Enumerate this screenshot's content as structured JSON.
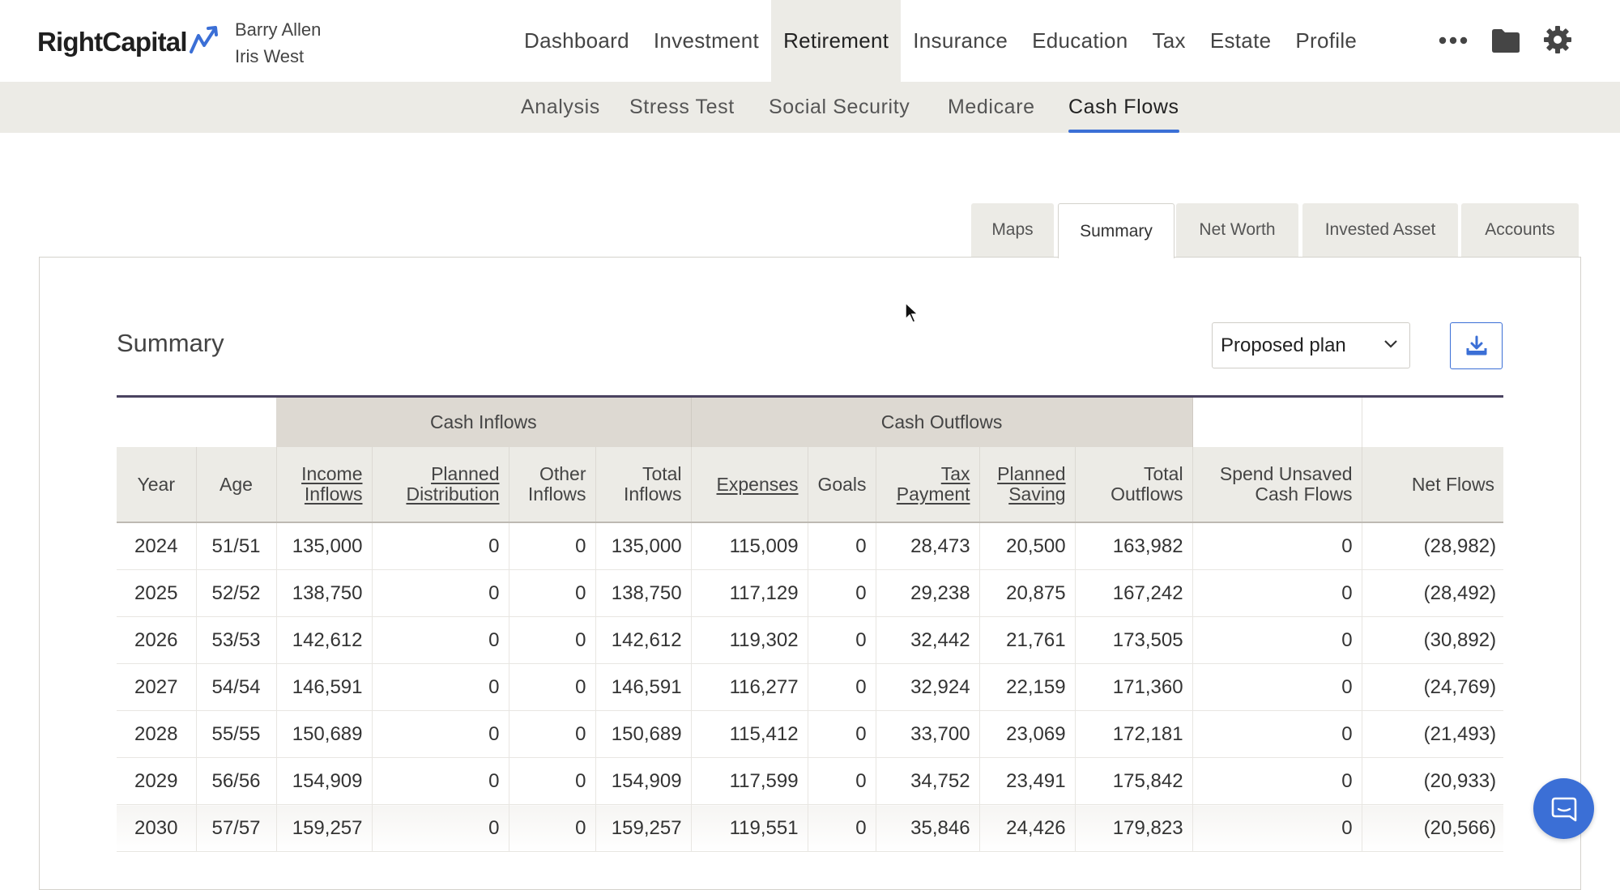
{
  "brand": {
    "logo": "RightCapital",
    "accent": "#3b6fd6"
  },
  "clients": [
    "Barry Allen",
    "Iris West"
  ],
  "main_nav": [
    {
      "label": "Dashboard",
      "active": false
    },
    {
      "label": "Investment",
      "active": false
    },
    {
      "label": "Retirement",
      "active": true
    },
    {
      "label": "Insurance",
      "active": false
    },
    {
      "label": "Education",
      "active": false
    },
    {
      "label": "Tax",
      "active": false
    },
    {
      "label": "Estate",
      "active": false
    },
    {
      "label": "Profile",
      "active": false
    }
  ],
  "nav_icons": {
    "more": "more-dots-icon",
    "folder": "folder-icon",
    "settings": "gear-icon"
  },
  "sub_nav": [
    {
      "label": "Analysis",
      "active": false
    },
    {
      "label": "Stress Test",
      "active": false
    },
    {
      "label": "Social Security",
      "active": false
    },
    {
      "label": "Medicare",
      "active": false
    },
    {
      "label": "Cash Flows",
      "active": true
    }
  ],
  "tabs": [
    {
      "label": "Maps",
      "active": false
    },
    {
      "label": "Summary",
      "active": true
    },
    {
      "label": "Net Worth",
      "active": false
    },
    {
      "label": "Invested Asset",
      "active": false
    },
    {
      "label": "Accounts",
      "active": false
    }
  ],
  "summary": {
    "title": "Summary",
    "plan_select": "Proposed plan",
    "download_icon": "download-icon"
  },
  "table": {
    "groups": {
      "inflows": "Cash Inflows",
      "outflows": "Cash Outflows"
    },
    "headers": [
      {
        "label": "Year",
        "underline": false
      },
      {
        "label": "Age",
        "underline": false
      },
      {
        "label": "Income Inflows",
        "underline": true
      },
      {
        "label": "Planned Distribution",
        "underline": true
      },
      {
        "label": "Other Inflows",
        "underline": false
      },
      {
        "label": "Total Inflows",
        "underline": false
      },
      {
        "label": "Expenses",
        "underline": true
      },
      {
        "label": "Goals",
        "underline": false
      },
      {
        "label": "Tax Payment",
        "underline": true
      },
      {
        "label": "Planned Saving",
        "underline": true
      },
      {
        "label": "Total Outflows",
        "underline": false
      },
      {
        "label": "Spend Unsaved Cash Flows",
        "underline": false
      },
      {
        "label": "Net Flows",
        "underline": false
      }
    ],
    "rows": [
      [
        "2024",
        "51/51",
        "135,000",
        "0",
        "0",
        "135,000",
        "115,009",
        "0",
        "28,473",
        "20,500",
        "163,982",
        "0",
        "(28,982)"
      ],
      [
        "2025",
        "52/52",
        "138,750",
        "0",
        "0",
        "138,750",
        "117,129",
        "0",
        "29,238",
        "20,875",
        "167,242",
        "0",
        "(28,492)"
      ],
      [
        "2026",
        "53/53",
        "142,612",
        "0",
        "0",
        "142,612",
        "119,302",
        "0",
        "32,442",
        "21,761",
        "173,505",
        "0",
        "(30,892)"
      ],
      [
        "2027",
        "54/54",
        "146,591",
        "0",
        "0",
        "146,591",
        "116,277",
        "0",
        "32,924",
        "22,159",
        "171,360",
        "0",
        "(24,769)"
      ],
      [
        "2028",
        "55/55",
        "150,689",
        "0",
        "0",
        "150,689",
        "115,412",
        "0",
        "33,700",
        "23,069",
        "172,181",
        "0",
        "(21,493)"
      ],
      [
        "2029",
        "56/56",
        "154,909",
        "0",
        "0",
        "154,909",
        "117,599",
        "0",
        "34,752",
        "23,491",
        "175,842",
        "0",
        "(20,933)"
      ],
      [
        "2030",
        "57/57",
        "159,257",
        "0",
        "0",
        "159,257",
        "119,551",
        "0",
        "35,846",
        "24,426",
        "179,823",
        "0",
        "(20,566)"
      ]
    ]
  },
  "chat_icon": "chat-icon"
}
